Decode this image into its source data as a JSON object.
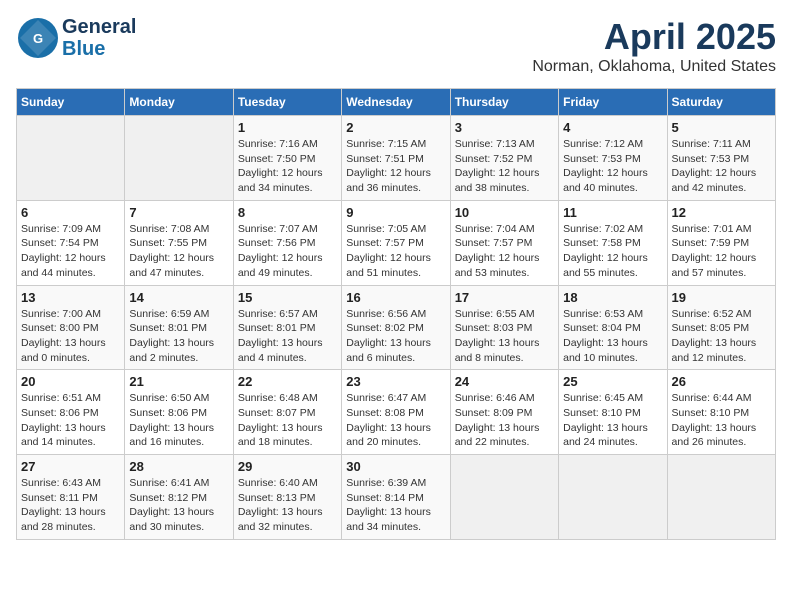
{
  "logo": {
    "line1": "General",
    "line2": "Blue"
  },
  "title": "April 2025",
  "subtitle": "Norman, Oklahoma, United States",
  "days_header": [
    "Sunday",
    "Monday",
    "Tuesday",
    "Wednesday",
    "Thursday",
    "Friday",
    "Saturday"
  ],
  "weeks": [
    [
      {
        "day": "",
        "info": ""
      },
      {
        "day": "",
        "info": ""
      },
      {
        "day": "1",
        "info": "Sunrise: 7:16 AM\nSunset: 7:50 PM\nDaylight: 12 hours\nand 34 minutes."
      },
      {
        "day": "2",
        "info": "Sunrise: 7:15 AM\nSunset: 7:51 PM\nDaylight: 12 hours\nand 36 minutes."
      },
      {
        "day": "3",
        "info": "Sunrise: 7:13 AM\nSunset: 7:52 PM\nDaylight: 12 hours\nand 38 minutes."
      },
      {
        "day": "4",
        "info": "Sunrise: 7:12 AM\nSunset: 7:53 PM\nDaylight: 12 hours\nand 40 minutes."
      },
      {
        "day": "5",
        "info": "Sunrise: 7:11 AM\nSunset: 7:53 PM\nDaylight: 12 hours\nand 42 minutes."
      }
    ],
    [
      {
        "day": "6",
        "info": "Sunrise: 7:09 AM\nSunset: 7:54 PM\nDaylight: 12 hours\nand 44 minutes."
      },
      {
        "day": "7",
        "info": "Sunrise: 7:08 AM\nSunset: 7:55 PM\nDaylight: 12 hours\nand 47 minutes."
      },
      {
        "day": "8",
        "info": "Sunrise: 7:07 AM\nSunset: 7:56 PM\nDaylight: 12 hours\nand 49 minutes."
      },
      {
        "day": "9",
        "info": "Sunrise: 7:05 AM\nSunset: 7:57 PM\nDaylight: 12 hours\nand 51 minutes."
      },
      {
        "day": "10",
        "info": "Sunrise: 7:04 AM\nSunset: 7:57 PM\nDaylight: 12 hours\nand 53 minutes."
      },
      {
        "day": "11",
        "info": "Sunrise: 7:02 AM\nSunset: 7:58 PM\nDaylight: 12 hours\nand 55 minutes."
      },
      {
        "day": "12",
        "info": "Sunrise: 7:01 AM\nSunset: 7:59 PM\nDaylight: 12 hours\nand 57 minutes."
      }
    ],
    [
      {
        "day": "13",
        "info": "Sunrise: 7:00 AM\nSunset: 8:00 PM\nDaylight: 13 hours\nand 0 minutes."
      },
      {
        "day": "14",
        "info": "Sunrise: 6:59 AM\nSunset: 8:01 PM\nDaylight: 13 hours\nand 2 minutes."
      },
      {
        "day": "15",
        "info": "Sunrise: 6:57 AM\nSunset: 8:01 PM\nDaylight: 13 hours\nand 4 minutes."
      },
      {
        "day": "16",
        "info": "Sunrise: 6:56 AM\nSunset: 8:02 PM\nDaylight: 13 hours\nand 6 minutes."
      },
      {
        "day": "17",
        "info": "Sunrise: 6:55 AM\nSunset: 8:03 PM\nDaylight: 13 hours\nand 8 minutes."
      },
      {
        "day": "18",
        "info": "Sunrise: 6:53 AM\nSunset: 8:04 PM\nDaylight: 13 hours\nand 10 minutes."
      },
      {
        "day": "19",
        "info": "Sunrise: 6:52 AM\nSunset: 8:05 PM\nDaylight: 13 hours\nand 12 minutes."
      }
    ],
    [
      {
        "day": "20",
        "info": "Sunrise: 6:51 AM\nSunset: 8:06 PM\nDaylight: 13 hours\nand 14 minutes."
      },
      {
        "day": "21",
        "info": "Sunrise: 6:50 AM\nSunset: 8:06 PM\nDaylight: 13 hours\nand 16 minutes."
      },
      {
        "day": "22",
        "info": "Sunrise: 6:48 AM\nSunset: 8:07 PM\nDaylight: 13 hours\nand 18 minutes."
      },
      {
        "day": "23",
        "info": "Sunrise: 6:47 AM\nSunset: 8:08 PM\nDaylight: 13 hours\nand 20 minutes."
      },
      {
        "day": "24",
        "info": "Sunrise: 6:46 AM\nSunset: 8:09 PM\nDaylight: 13 hours\nand 22 minutes."
      },
      {
        "day": "25",
        "info": "Sunrise: 6:45 AM\nSunset: 8:10 PM\nDaylight: 13 hours\nand 24 minutes."
      },
      {
        "day": "26",
        "info": "Sunrise: 6:44 AM\nSunset: 8:10 PM\nDaylight: 13 hours\nand 26 minutes."
      }
    ],
    [
      {
        "day": "27",
        "info": "Sunrise: 6:43 AM\nSunset: 8:11 PM\nDaylight: 13 hours\nand 28 minutes."
      },
      {
        "day": "28",
        "info": "Sunrise: 6:41 AM\nSunset: 8:12 PM\nDaylight: 13 hours\nand 30 minutes."
      },
      {
        "day": "29",
        "info": "Sunrise: 6:40 AM\nSunset: 8:13 PM\nDaylight: 13 hours\nand 32 minutes."
      },
      {
        "day": "30",
        "info": "Sunrise: 6:39 AM\nSunset: 8:14 PM\nDaylight: 13 hours\nand 34 minutes."
      },
      {
        "day": "",
        "info": ""
      },
      {
        "day": "",
        "info": ""
      },
      {
        "day": "",
        "info": ""
      }
    ]
  ]
}
